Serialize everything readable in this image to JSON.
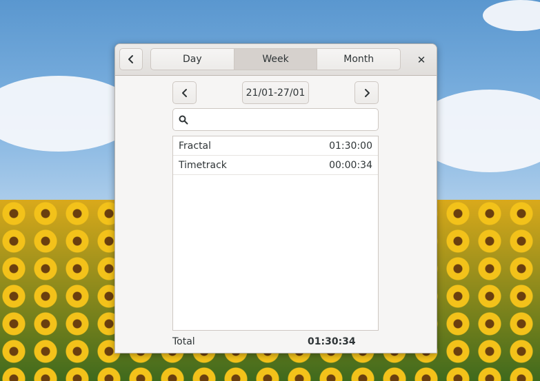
{
  "header": {
    "tabs": [
      {
        "label": "Day",
        "active": false
      },
      {
        "label": "Week",
        "active": true
      },
      {
        "label": "Month",
        "active": false
      }
    ],
    "close_icon": "✕"
  },
  "navigation": {
    "range_label": "21/01-27/01",
    "prev_icon": "chevron-left",
    "next_icon": "chevron-right"
  },
  "search": {
    "value": "",
    "placeholder": ""
  },
  "entries": [
    {
      "name": "Fractal",
      "time": "01:30:00"
    },
    {
      "name": "Timetrack",
      "time": "00:00:34"
    }
  ],
  "total": {
    "label": "Total",
    "value": "01:30:34"
  },
  "colors": {
    "active_tab": "#d6d1cd",
    "window_bg": "#f6f5f4"
  }
}
